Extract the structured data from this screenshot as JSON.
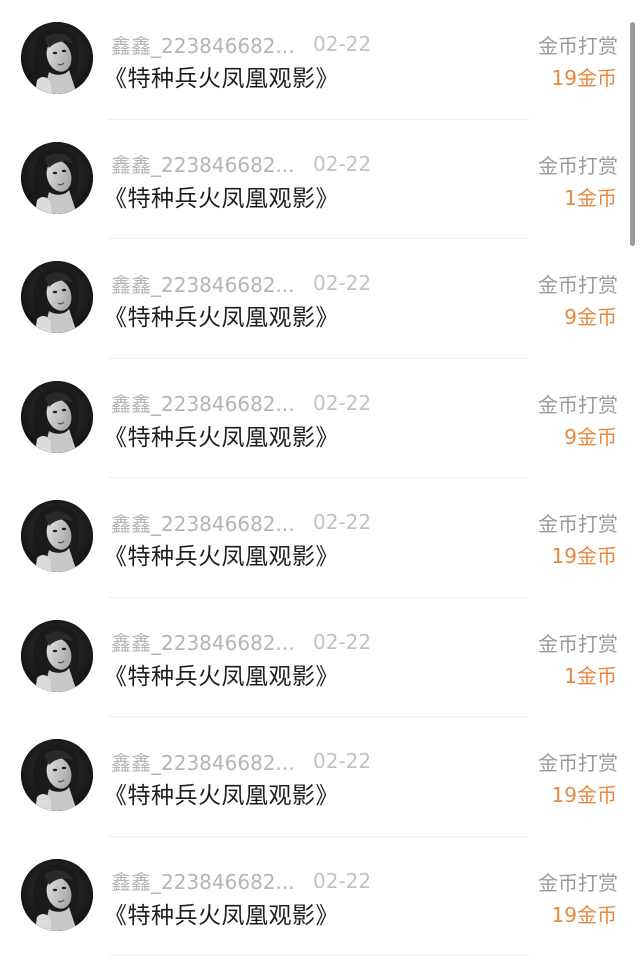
{
  "reward_list": {
    "items": [
      {
        "username": "鑫鑫_223846682...",
        "date": "02-22",
        "title": "《特种兵火凤凰观影》",
        "action": "金币打赏",
        "amount": "19金币"
      },
      {
        "username": "鑫鑫_223846682...",
        "date": "02-22",
        "title": "《特种兵火凤凰观影》",
        "action": "金币打赏",
        "amount": "1金币"
      },
      {
        "username": "鑫鑫_223846682...",
        "date": "02-22",
        "title": "《特种兵火凤凰观影》",
        "action": "金币打赏",
        "amount": "9金币"
      },
      {
        "username": "鑫鑫_223846682...",
        "date": "02-22",
        "title": "《特种兵火凤凰观影》",
        "action": "金币打赏",
        "amount": "9金币"
      },
      {
        "username": "鑫鑫_223846682...",
        "date": "02-22",
        "title": "《特种兵火凤凰观影》",
        "action": "金币打赏",
        "amount": "19金币"
      },
      {
        "username": "鑫鑫_223846682...",
        "date": "02-22",
        "title": "《特种兵火凤凰观影》",
        "action": "金币打赏",
        "amount": "1金币"
      },
      {
        "username": "鑫鑫_223846682...",
        "date": "02-22",
        "title": "《特种兵火凤凰观影》",
        "action": "金币打赏",
        "amount": "19金币"
      },
      {
        "username": "鑫鑫_223846682...",
        "date": "02-22",
        "title": "《特种兵火凤凰观影》",
        "action": "金币打赏",
        "amount": "19金币"
      }
    ]
  },
  "colors": {
    "amount": "#e8883e",
    "secondary_text": "#b5b5b5",
    "primary_text": "#1e1e1e"
  },
  "icons": {
    "avatar": "user-avatar-photo-icon"
  }
}
